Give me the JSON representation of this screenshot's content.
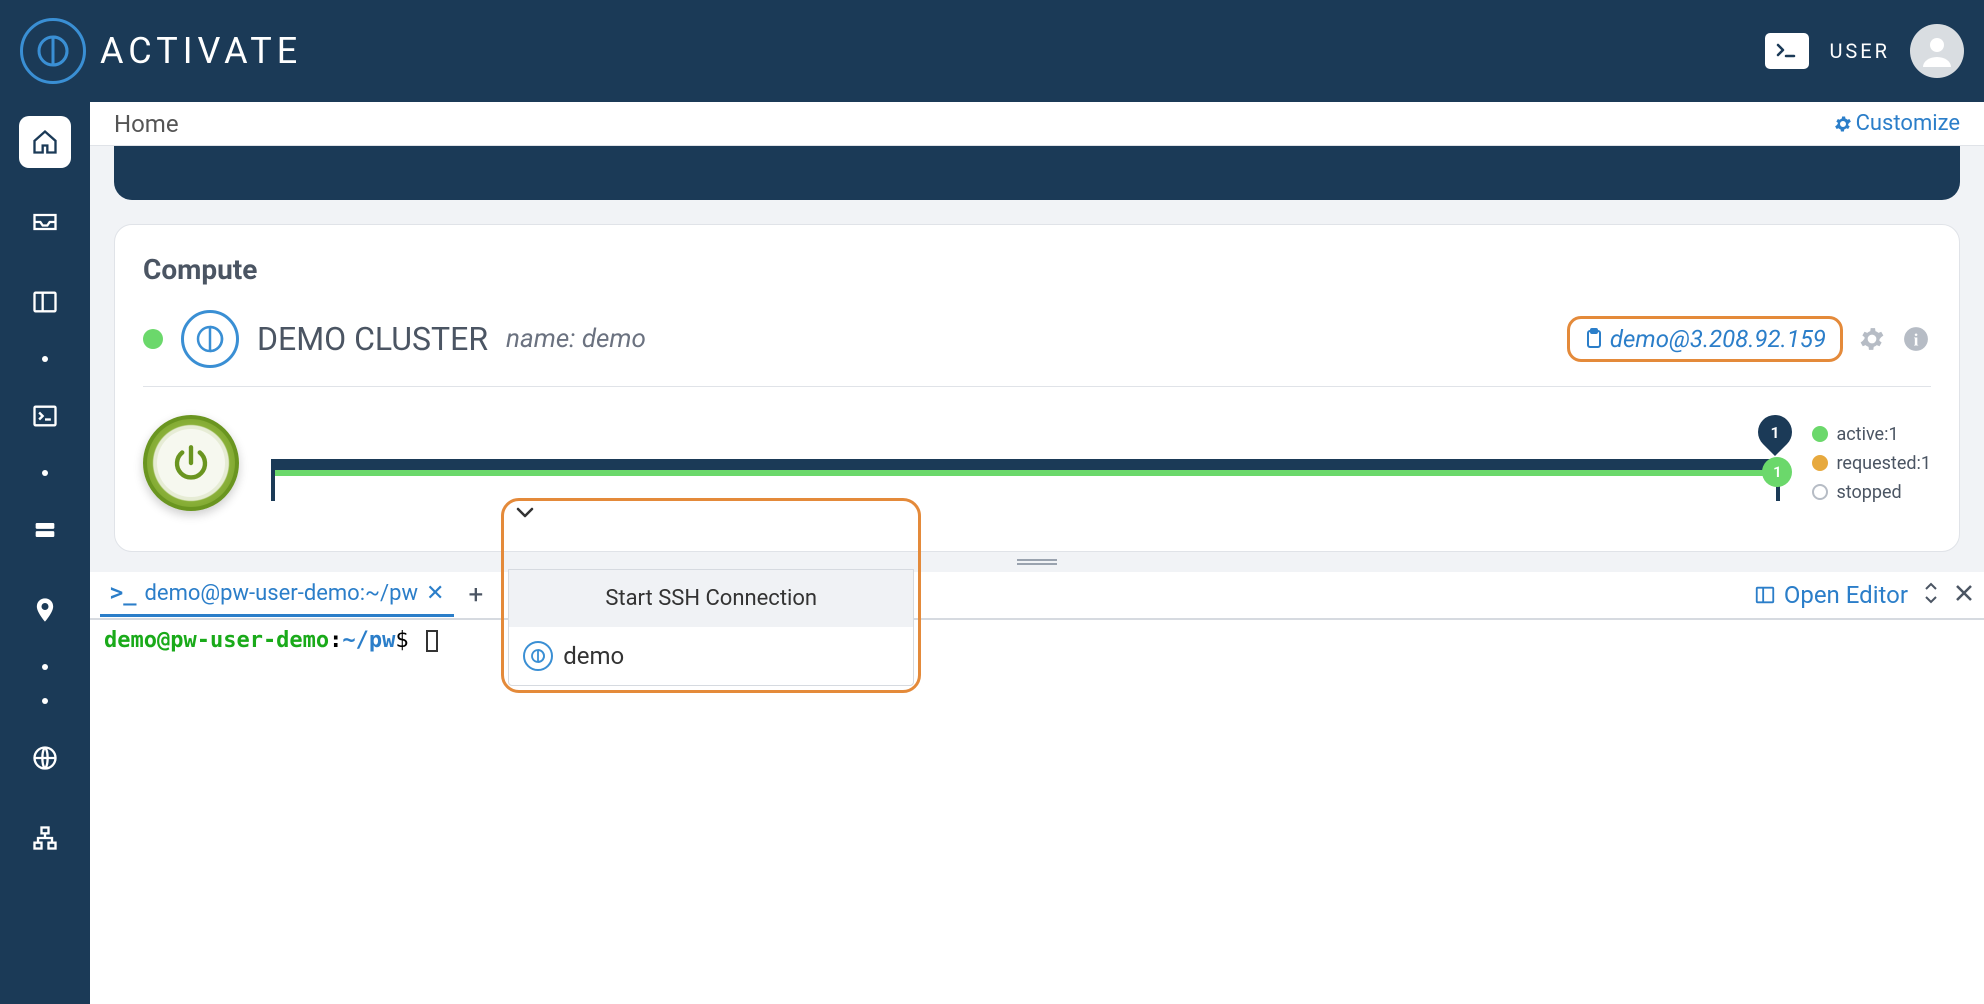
{
  "header": {
    "brand": "ACTIVATE",
    "user_label": "USER"
  },
  "breadcrumb": {
    "home": "Home",
    "customize": "Customize"
  },
  "compute": {
    "section_title": "Compute",
    "cluster_name": "DEMO CLUSTER",
    "cluster_subname_label": "name:",
    "cluster_subname_value": "demo",
    "ssh_address": "demo@3.208.92.159",
    "timeline": {
      "marker_dark": "1",
      "marker_green": "1"
    },
    "legend": {
      "active": "active:1",
      "requested": "requested:1",
      "stopped": "stopped"
    }
  },
  "terminal": {
    "tab_label": "demo@pw-user-demo:~/pw",
    "dropdown_title": "Start SSH Connection",
    "dropdown_option": "demo",
    "open_editor": "Open Editor",
    "prompt": {
      "user_host": "demo@pw-user-demo",
      "sep": ":",
      "path": "~/pw",
      "dollar": "$"
    }
  }
}
